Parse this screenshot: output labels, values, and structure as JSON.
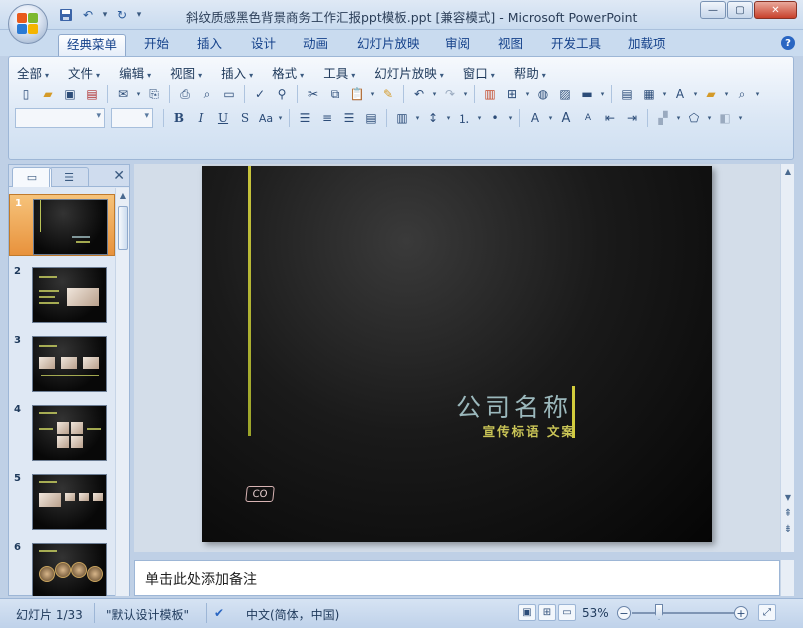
{
  "window": {
    "title": "斜纹质感黑色背景商务工作汇报ppt模板.ppt [兼容模式] - Microsoft PowerPoint",
    "min_glyph": "—",
    "max_glyph": "▢",
    "close_glyph": "✕"
  },
  "qat": [
    "save-icon",
    "undo-icon",
    "redo-icon",
    "customize-icon"
  ],
  "tabs": [
    "经典菜单",
    "开始",
    "插入",
    "设计",
    "动画",
    "幻灯片放映",
    "审阅",
    "视图",
    "开发工具",
    "加载项"
  ],
  "active_tab": "经典菜单",
  "help_glyph": "?",
  "menus": [
    "全部",
    "文件",
    "编辑",
    "视图",
    "插入",
    "格式",
    "工具",
    "幻灯片放映",
    "窗口",
    "帮助"
  ],
  "format_buttons": {
    "bold": "B",
    "italic": "I",
    "underline": "U",
    "shadow": "S",
    "font_size": "Aa"
  },
  "panel": {
    "close_glyph": "✕"
  },
  "thumbnails": [
    {
      "num": "1"
    },
    {
      "num": "2"
    },
    {
      "num": "3"
    },
    {
      "num": "4"
    },
    {
      "num": "5"
    },
    {
      "num": "6"
    }
  ],
  "slide": {
    "company_name": "公司名称",
    "slogan": "宣传标语 文案",
    "logo_text": "CO"
  },
  "notes": {
    "placeholder": "单击此处添加备注"
  },
  "status": {
    "slide_info": "幻灯片 1/33",
    "theme": "\"默认设计模板\"",
    "language": "中文(简体，中国)",
    "zoom": "53%"
  },
  "colors": {
    "accent_bar": "#c8c43c",
    "company_text": "#9bb8bc",
    "slogan_text": "#c9c456",
    "selected_thumb": "#e8923c"
  }
}
